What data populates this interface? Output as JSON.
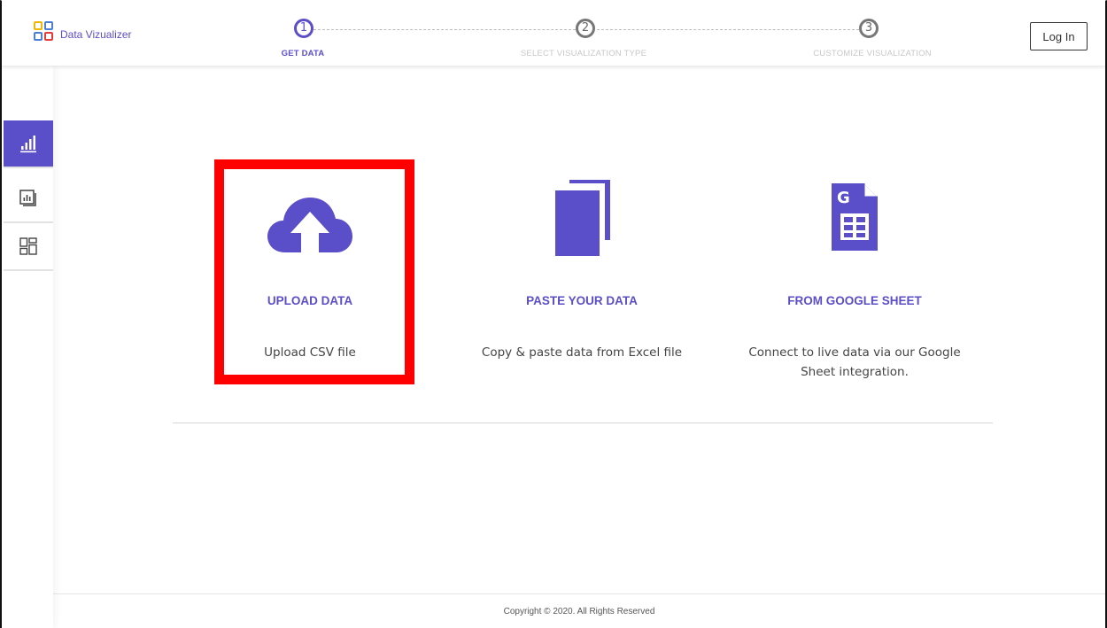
{
  "app": {
    "title": "Data Vizualizer"
  },
  "header": {
    "steps": [
      {
        "number": "1",
        "label": "GET DATA"
      },
      {
        "number": "2",
        "label": "SELECT VISUALIZATION TYPE"
      },
      {
        "number": "3",
        "label": "CUSTOMIZE VISUALIZATION"
      }
    ],
    "login_label": "Log In"
  },
  "sidebar": {
    "items": [
      {
        "icon": "bar-chart-icon",
        "active": true
      },
      {
        "icon": "chart-frame-icon",
        "active": false
      },
      {
        "icon": "grid-layout-icon",
        "active": false
      }
    ]
  },
  "main": {
    "options": [
      {
        "icon": "cloud-upload-icon",
        "title": "UPLOAD DATA",
        "description": "Upload CSV file"
      },
      {
        "icon": "copy-paste-icon",
        "title": "PASTE YOUR DATA",
        "description": "Copy & paste data from Excel file"
      },
      {
        "icon": "google-sheet-icon",
        "title": "FROM GOOGLE SHEET",
        "description": "Connect to live data via our Google Sheet integration."
      }
    ]
  },
  "footer": {
    "copyright": "Copyright © 2020. All Rights Reserved"
  },
  "colors": {
    "accent": "#5b4ec9",
    "highlight": "#ff0000"
  }
}
